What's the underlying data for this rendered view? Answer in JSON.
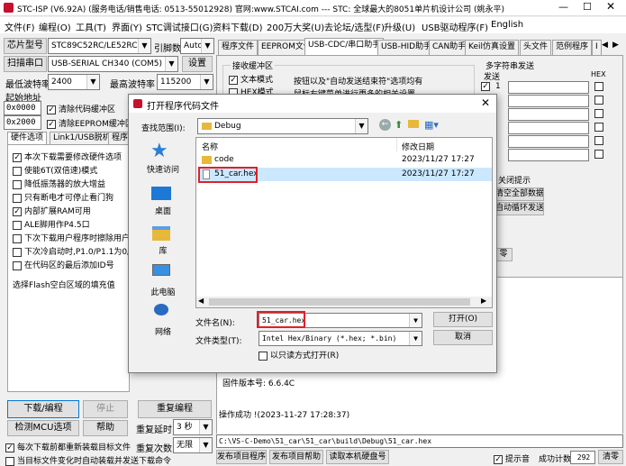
{
  "window": {
    "title": "STC-ISP (V6.92A) (服务电话/销售电话: 0513-55012928) 官网:www.STCAI.com --- STC: 全球最大的8051单片机设计公司 (姚永平)"
  },
  "menu": [
    "文件(F)",
    "编程(O)",
    "工具(T)",
    "界面(Y)",
    "STC调试接口(G)",
    "资料下载(D)",
    "200万大奖(U)",
    "去论坛/选型(F)",
    "升级(U)",
    "USB驱动程序(F)",
    "English"
  ],
  "left": {
    "chip_label": "芯片型号",
    "chip_value": "STC89C52RC/LE52RC",
    "pin_label": "引脚数",
    "pin_value": "Auto",
    "scan_button": "扫描串口",
    "port_value": "USB-SERIAL CH340 (COM5)",
    "settings_button": "设置",
    "min_baud_label": "最低波特率",
    "min_baud_value": "2400",
    "max_baud_label": "最高波特率",
    "max_baud_value": "115200",
    "start_addr_label": "起始地址",
    "addr1": "0x0000",
    "clear_code": "清除代码缓冲区",
    "addr2": "0x2000",
    "clear_eeprom": "清除EEPROM缓冲区",
    "tabs": [
      "硬件选项",
      "Link1/USB脱机",
      "程序加"
    ],
    "options": [
      {
        "label": "本次下载需要修改硬件选项",
        "checked": true
      },
      {
        "label": "使能6T(双倍速)模式",
        "checked": false
      },
      {
        "label": "降低振荡器的放大增益",
        "checked": false
      },
      {
        "label": "只有断电才可停止看门狗",
        "checked": false
      },
      {
        "label": "内部扩展RAM可用",
        "checked": true
      },
      {
        "label": "ALE脚用作P4.5口",
        "checked": false
      },
      {
        "label": "下次下载用户程序时擦除用户",
        "checked": false
      },
      {
        "label": "下次冷启动时,P1.0/P1.1为0/",
        "checked": false
      },
      {
        "label": "在代码区的最后添加ID号",
        "checked": false
      }
    ],
    "fill_label": "选择Flash空白区域的填充值",
    "download_button": "下载/编程",
    "stop_button": "停止",
    "reprogram_button": "重复编程",
    "detect_button": "检测MCU选项",
    "help_button": "帮助",
    "repeat_delay_label": "重复延时",
    "repeat_delay_value": "3 秒",
    "repeat_count_label": "重复次数",
    "repeat_count_value": "无限",
    "reload_label": "每次下载前都重新装载目标文件",
    "auto_label": "当目标文件变化时自动装载并发送下载命令"
  },
  "right": {
    "tabs": [
      "程序文件",
      "EEPROM文件",
      "USB-CDC/串口助手",
      "USB-HID助手",
      "CAN助手",
      "Keil仿真设置",
      "头文件",
      "范例程序",
      "I"
    ],
    "recv_group": "接收缓冲区",
    "text_mode": "文本模式",
    "hex_mode": "HEX模式",
    "hint_line1": "按钮以及\"自动发送结束符\"选项均有",
    "hint_line2": "鼠标右键菜单进行更多的相关设置",
    "multi_send": "多字符串发送",
    "send_col": "发送",
    "hex_col": "HEX",
    "row_index": "1",
    "close_hint": "关闭提示",
    "clear_all": "清空全部数据",
    "auto_loop": "自动循环发送",
    "zero_btn": "零",
    "fw_version": "固件版本号: 6.6.4C",
    "op_success": "操作成功 !(2023-11-27 17:28:37)",
    "path": "C:\\VS-C-Demo\\51_car\\51_car\\build\\Debug\\51_car.hex",
    "publish_project": "发布项目程序",
    "publish_help": "发布项目帮助",
    "read_disk": "读取本机硬盘号",
    "hint_sound": "提示音",
    "success_count_label": "成功计数",
    "success_count": "292",
    "clear_btn": "清零"
  },
  "dialog": {
    "title": "打开程序代码文件",
    "lookin_label": "查找范围(I):",
    "lookin_value": "Debug",
    "col_name": "名称",
    "col_date": "修改日期",
    "files": [
      {
        "name": "code",
        "date": "2023/11/27 17:27",
        "type": "folder"
      },
      {
        "name": "51_car.hex",
        "date": "2023/11/27 17:27",
        "type": "file"
      }
    ],
    "places": [
      "快速访问",
      "桌面",
      "库",
      "此电脑",
      "网络"
    ],
    "filename_label": "文件名(N):",
    "filename_value": "51_car.hex",
    "filetype_label": "文件类型(T):",
    "filetype_value": "Intel Hex/Binary (*.hex; *.bin)",
    "readonly_label": "以只读方式打开(R)",
    "open_button": "打开(O)",
    "cancel_button": "取消"
  }
}
